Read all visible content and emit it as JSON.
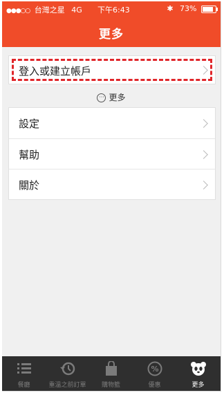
{
  "status": {
    "carrier": "台灣之星",
    "network": "4G",
    "time": "下午6:43",
    "battery": "73%",
    "battery_level": 0.73
  },
  "header": {
    "title": "更多"
  },
  "login": {
    "label": "登入或建立帳戶"
  },
  "more_hint": {
    "label": "更多"
  },
  "menu": {
    "items": [
      {
        "label": "設定"
      },
      {
        "label": "幫助"
      },
      {
        "label": "關於"
      }
    ]
  },
  "tabbar": {
    "tabs": [
      {
        "label": "餐廳",
        "icon": "list-icon"
      },
      {
        "label": "重溫之前訂單",
        "icon": "history-icon"
      },
      {
        "label": "購物籃",
        "icon": "basket-icon"
      },
      {
        "label": "優惠",
        "icon": "percent-icon"
      },
      {
        "label": "更多",
        "icon": "panda-icon",
        "active": true
      }
    ]
  },
  "colors": {
    "brand": "#f04c29",
    "highlight": "#e0262a",
    "tab_bg": "#2f2f2f"
  }
}
